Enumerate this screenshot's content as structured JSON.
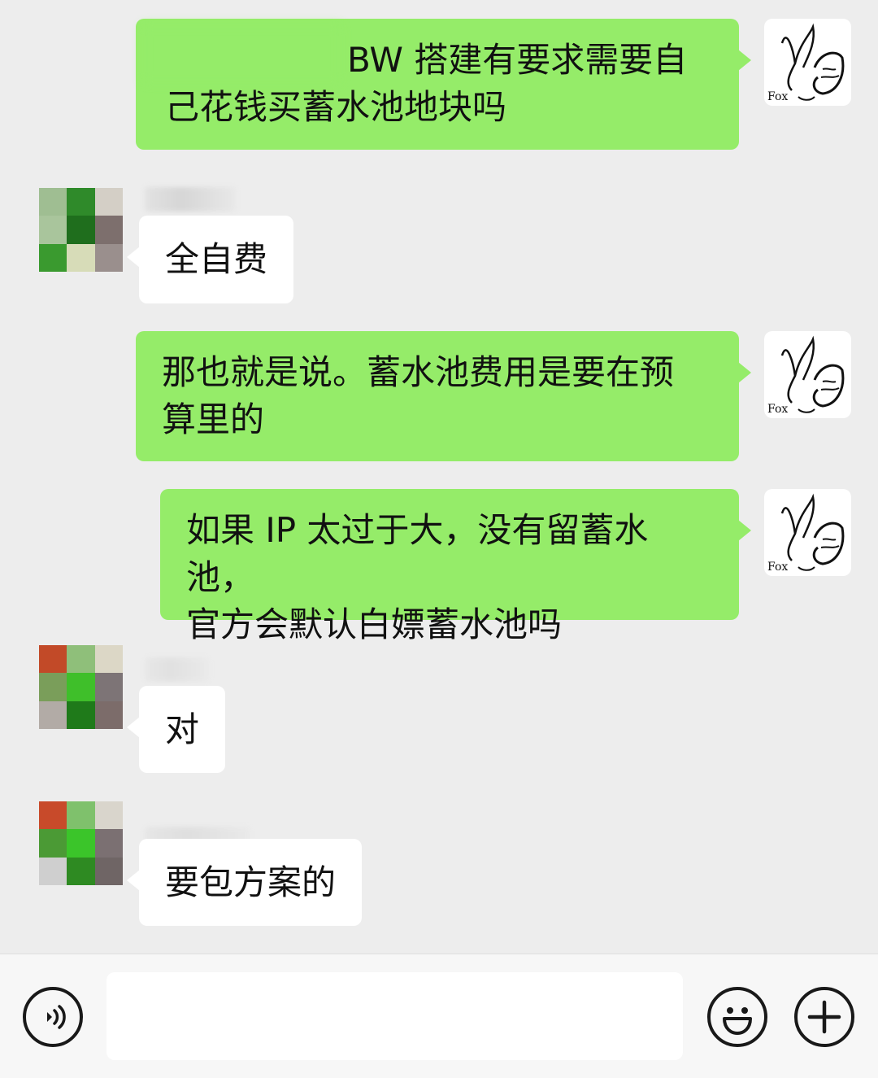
{
  "messages": [
    {
      "id": 1,
      "direction": "out",
      "text_line1": "BW 搭建有要求需要自",
      "text_line2": "己花钱买蓄水池地块吗"
    },
    {
      "id": 2,
      "direction": "in",
      "text": "全自费"
    },
    {
      "id": 3,
      "direction": "out",
      "text_line1": "那也就是说。蓄水池费用是要在预",
      "text_line2": "算里的"
    },
    {
      "id": 4,
      "direction": "out",
      "text_line1": "如果 IP 太过于大，没有留蓄水池，",
      "text_line2": "官方会默认白嫖蓄水池吗"
    },
    {
      "id": 5,
      "direction": "in",
      "text": "对"
    },
    {
      "id": 6,
      "direction": "in",
      "text": "要包方案的"
    }
  ],
  "self_avatar": {
    "signature": "Fox"
  },
  "input_bar": {
    "left_icon": "voice-icon",
    "emoji_icon": "emoji-icon",
    "plus_icon": "plus-icon"
  },
  "colors": {
    "background": "#ededed",
    "outgoing_bubble": "#95ec69",
    "incoming_bubble": "#ffffff"
  }
}
